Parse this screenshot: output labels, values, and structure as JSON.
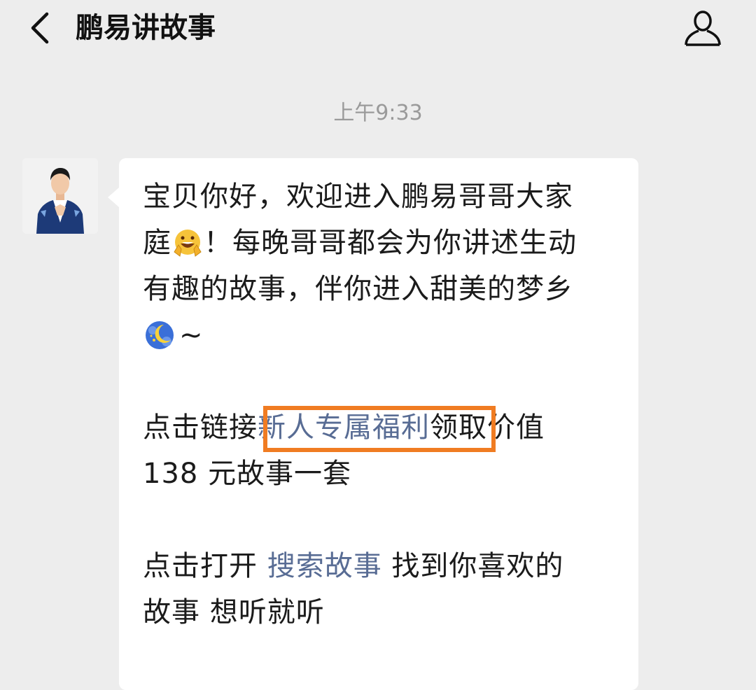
{
  "header": {
    "title": "鹏易讲故事",
    "back_icon": "chevron-left-icon",
    "profile_icon": "person-icon"
  },
  "chat": {
    "timestamp": "上午9:33",
    "message": {
      "line1": "宝贝你好，欢迎进入鹏易哥哥大家",
      "line2_a": "庭",
      "line2_b": "！每晚哥哥都会为你讲述生动",
      "line3": "有趣的故事，伴你进入甜美的梦乡",
      "line4": "~",
      "p2_a": "点击链接",
      "p2_link": "新人专属福利",
      "p2_b": "领取价值",
      "p2_line2": "138 元故事一套",
      "p3_a": "点击打开 ",
      "p3_link": "搜索故事",
      "p3_b": " 找到你喜欢的",
      "p3_line2": "故事 想听就听"
    },
    "emoji_names": [
      "grinning-face-hands-emoji",
      "moon-emoji"
    ]
  },
  "colors": {
    "background": "#ededed",
    "bubble": "#ffffff",
    "link": "#586c94",
    "highlight_box": "#f07c22"
  }
}
